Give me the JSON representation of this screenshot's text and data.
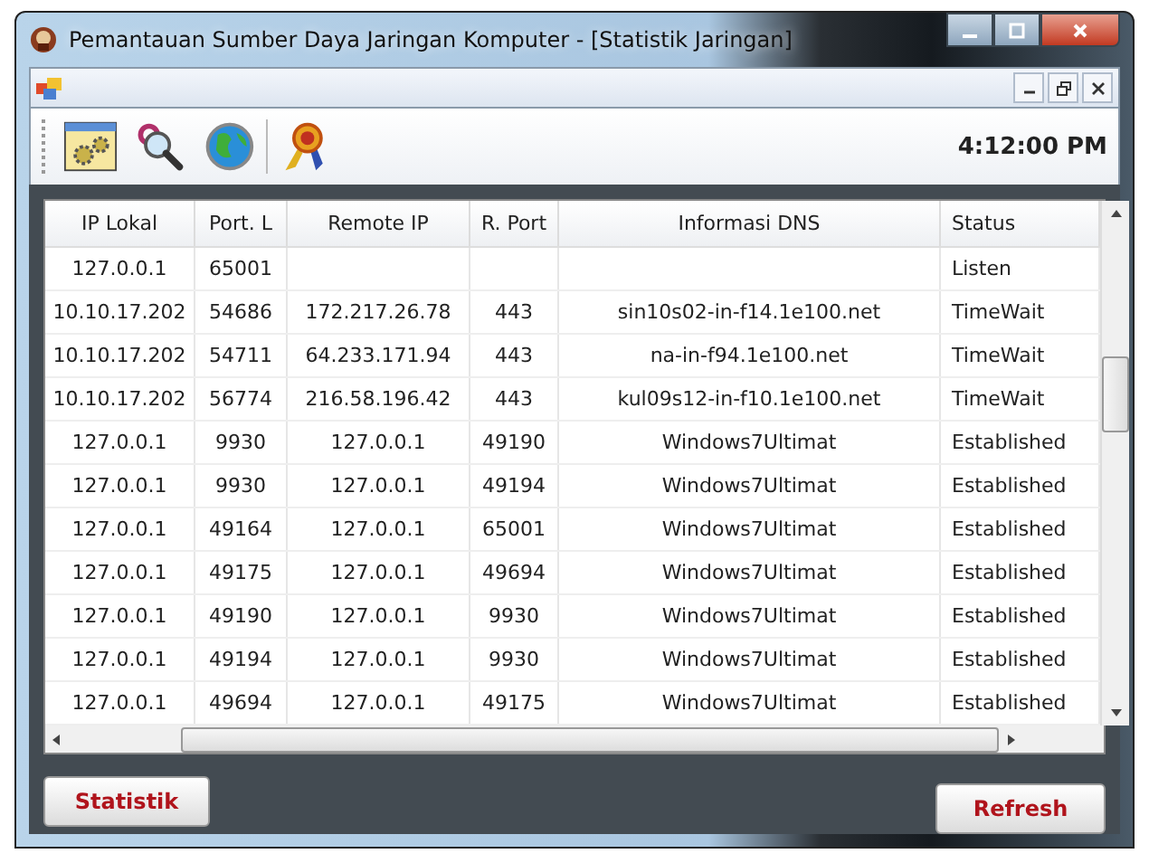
{
  "window": {
    "title": "Pemantauan Sumber Daya Jaringan Komputer - [Statistik Jaringan]"
  },
  "toolbar": {
    "clock": "4:12:00 PM"
  },
  "table": {
    "columns": [
      "IP Lokal",
      "Port. L",
      "Remote IP",
      "R. Port",
      "Informasi DNS",
      "Status"
    ],
    "rows": [
      [
        "127.0.0.1",
        "65001",
        "",
        "",
        "",
        "Listen"
      ],
      [
        "10.10.17.202",
        "54686",
        "172.217.26.78",
        "443",
        "sin10s02-in-f14.1e100.net",
        "TimeWait"
      ],
      [
        "10.10.17.202",
        "54711",
        "64.233.171.94",
        "443",
        "na-in-f94.1e100.net",
        "TimeWait"
      ],
      [
        "10.10.17.202",
        "56774",
        "216.58.196.42",
        "443",
        "kul09s12-in-f10.1e100.net",
        "TimeWait"
      ],
      [
        "127.0.0.1",
        "9930",
        "127.0.0.1",
        "49190",
        "Windows7Ultimat",
        "Established"
      ],
      [
        "127.0.0.1",
        "9930",
        "127.0.0.1",
        "49194",
        "Windows7Ultimat",
        "Established"
      ],
      [
        "127.0.0.1",
        "49164",
        "127.0.0.1",
        "65001",
        "Windows7Ultimat",
        "Established"
      ],
      [
        "127.0.0.1",
        "49175",
        "127.0.0.1",
        "49694",
        "Windows7Ultimat",
        "Established"
      ],
      [
        "127.0.0.1",
        "49190",
        "127.0.0.1",
        "9930",
        "Windows7Ultimat",
        "Established"
      ],
      [
        "127.0.0.1",
        "49194",
        "127.0.0.1",
        "9930",
        "Windows7Ultimat",
        "Established"
      ],
      [
        "127.0.0.1",
        "49694",
        "127.0.0.1",
        "49175",
        "Windows7Ultimat",
        "Established"
      ]
    ]
  },
  "buttons": [
    "Statistik",
    "Refresh"
  ]
}
